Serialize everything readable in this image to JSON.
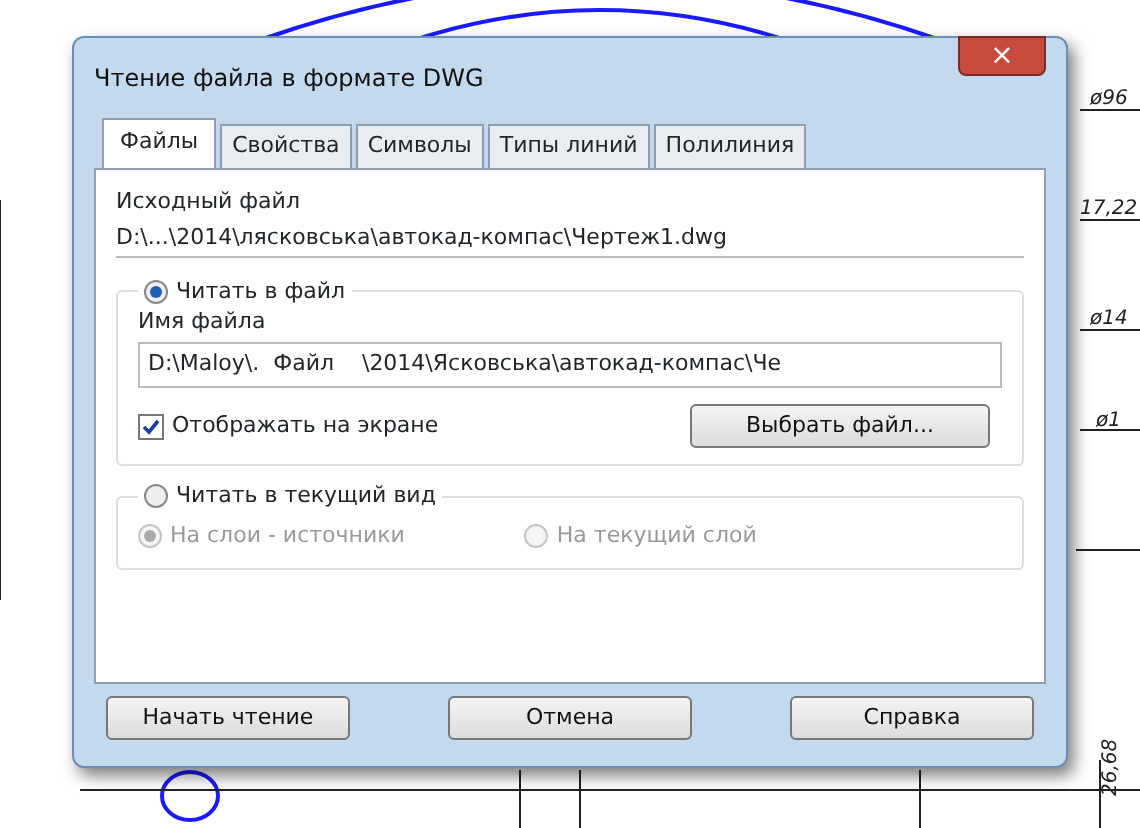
{
  "drawing_labels": [
    {
      "text": "ø96",
      "kind": "right"
    },
    {
      "text": "17,22",
      "kind": "right"
    },
    {
      "text": "ø14",
      "kind": "right"
    },
    {
      "text": "ø1",
      "kind": "right"
    },
    {
      "text": "26,68",
      "kind": "vertical"
    }
  ],
  "window": {
    "title": "Чтение файла в формате DWG",
    "close": "×"
  },
  "tabs": [
    {
      "label": "Файлы",
      "selected": true
    },
    {
      "label": "Свойства",
      "selected": false
    },
    {
      "label": "Символы",
      "selected": false
    },
    {
      "label": "Типы линий",
      "selected": false
    },
    {
      "label": "Полилиния",
      "selected": false
    }
  ],
  "source": {
    "label": "Исходный файл",
    "path": "D:\\...\\2014\\лясковська\\автокад-компас\\Чертеж1.dwg"
  },
  "groups": [
    {
      "label": "Читать в файл",
      "selected": true,
      "field_label": "Имя файла",
      "field_value": "D:\\Maloy\\.  Файл    \\2014\\Ясковська\\автокад-компас\\Че",
      "checkbox": {
        "label": "Отображать на экране",
        "checked": true
      },
      "button": "Выбрать файл..."
    },
    {
      "label": "Читать в текущий вид",
      "selected": false,
      "options": [
        {
          "label": "На слои - источники",
          "selected": true,
          "disabled": true
        },
        {
          "label": "На текущий слой",
          "selected": false,
          "disabled": true
        }
      ]
    }
  ],
  "buttons": [
    "Начать чтение",
    "Отмена",
    "Справка"
  ]
}
